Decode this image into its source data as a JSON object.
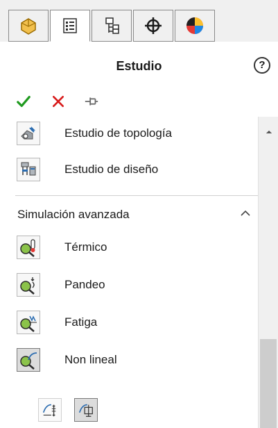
{
  "tabs": [
    {
      "name": "featuremanager-tab",
      "icon": "part-icon"
    },
    {
      "name": "propertymanager-tab",
      "icon": "property-list-icon",
      "active": true
    },
    {
      "name": "configuration-tab",
      "icon": "configuration-icon"
    },
    {
      "name": "dimxpert-tab",
      "icon": "crosshair-icon"
    },
    {
      "name": "display-tab",
      "icon": "appearance-icon"
    }
  ],
  "header": {
    "title": "Estudio",
    "help": "?"
  },
  "actions": {
    "ok": "✓",
    "cancel": "✕",
    "pin": "pin-icon"
  },
  "items_top": [
    {
      "label": "Estudio de topología",
      "icon": "topology-study-icon"
    },
    {
      "label": "Estudio de diseño",
      "icon": "design-study-icon"
    }
  ],
  "section": {
    "label": "Simulación avanzada",
    "collapsed": false
  },
  "items_advanced": [
    {
      "label": "Térmico",
      "icon": "thermal-icon"
    },
    {
      "label": "Pandeo",
      "icon": "buckling-icon"
    },
    {
      "label": "Fatiga",
      "icon": "fatigue-icon"
    },
    {
      "label": "Non lineal",
      "icon": "nonlinear-icon",
      "selected": true
    }
  ],
  "sub_options": [
    {
      "icon": "nonlinear-static-icon",
      "selected": false
    },
    {
      "icon": "nonlinear-dynamic-icon",
      "selected": true
    }
  ],
  "colors": {
    "ok": "#1f9a1f",
    "cancel": "#d81b1b",
    "accent": "#2b6cb0"
  }
}
